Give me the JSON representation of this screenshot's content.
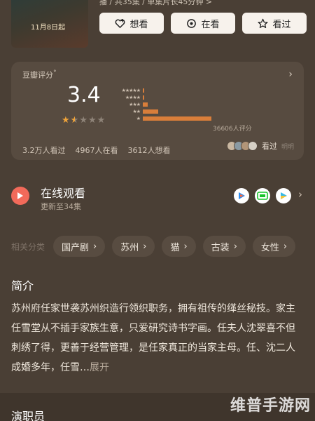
{
  "header": {
    "poster_date": "11月8日起",
    "poster_sub": "",
    "meta_line": "播 / 共35集 / 单集片长45分钟 >",
    "actions": [
      {
        "label": "想看",
        "icon": "heart-plus-icon"
      },
      {
        "label": "在看",
        "icon": "target-icon"
      },
      {
        "label": "看过",
        "icon": "star-icon"
      }
    ]
  },
  "rating": {
    "label": "豆瓣评分",
    "mark": "°",
    "score": "3.4",
    "stars_filled": 1.5,
    "stars_total": 5,
    "distribution": [
      {
        "stars": "★★★★★",
        "fraction": 0.01
      },
      {
        "stars": "★★★★",
        "fraction": 0.01
      },
      {
        "stars": "★★★",
        "fraction": 0.05
      },
      {
        "stars": "★★",
        "fraction": 0.17
      },
      {
        "stars": "★",
        "fraction": 0.75
      }
    ],
    "count_text": "36606人评分",
    "watched": "3.2万人看过",
    "watching": "4967人在看",
    "want": "3612人想看",
    "seen_label": "看过",
    "seen_more": "明明"
  },
  "online": {
    "title": "在线观看",
    "subtitle": "更新至34集",
    "apps": [
      "tencent-video-icon",
      "iqiyi-icon",
      "youku-icon"
    ]
  },
  "tags": {
    "label": "相关分类",
    "items": [
      "国产剧",
      "苏州",
      "猫",
      "古装",
      "女性"
    ]
  },
  "intro": {
    "title": "简介",
    "text": "苏州府任家世袭苏州织造行领织职务，拥有祖传的缂丝秘技。家主任雪堂从不插手家族生意，只爱研究诗书字画。任夫人沈翠喜不但刺绣了得，更善于经营管理，是任家真正的当家主母。任、沈二人成婚多年，任雪…",
    "more": "展开"
  },
  "cast": {
    "title": "演职员"
  },
  "watermark": "维普手游网",
  "colors": {
    "accent_orange": "#d97e3a",
    "star_on": "#f0a43a",
    "play_red": "#f26a5a"
  }
}
